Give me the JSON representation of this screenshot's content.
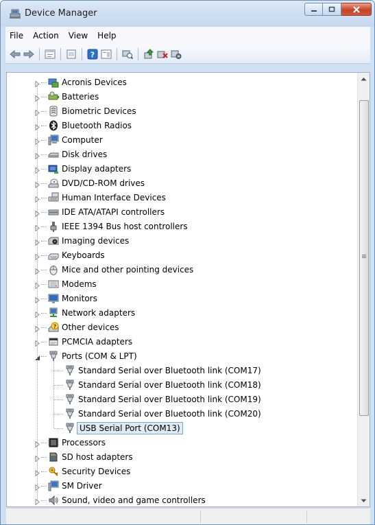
{
  "window": {
    "title": "Device Manager",
    "icons": {
      "app": "device-manager-icon",
      "minimize": "minimize-icon",
      "maximize": "maximize-icon",
      "close": "close-icon"
    },
    "accent": "#c7442a"
  },
  "menu": {
    "items": [
      "File",
      "Action",
      "View",
      "Help"
    ]
  },
  "toolbar": {
    "buttons": [
      "back-icon",
      "forward-icon",
      "properties-icon",
      "show-hidden-icon",
      "help-icon",
      "action-pane-icon",
      "scan-hardware-icon",
      "update-driver-icon",
      "uninstall-icon",
      "disable-icon"
    ]
  },
  "tree": {
    "nodes": [
      {
        "label": "Acronis Devices",
        "icon": "acronis-icon"
      },
      {
        "label": "Batteries",
        "icon": "battery-icon"
      },
      {
        "label": "Biometric Devices",
        "icon": "biometric-icon"
      },
      {
        "label": "Bluetooth Radios",
        "icon": "bluetooth-icon"
      },
      {
        "label": "Computer",
        "icon": "computer-icon"
      },
      {
        "label": "Disk drives",
        "icon": "disk-drive-icon"
      },
      {
        "label": "Display adapters",
        "icon": "display-adapter-icon"
      },
      {
        "label": "DVD/CD-ROM drives",
        "icon": "dvd-drive-icon"
      },
      {
        "label": "Human Interface Devices",
        "icon": "hid-icon"
      },
      {
        "label": "IDE ATA/ATAPI controllers",
        "icon": "ide-controller-icon"
      },
      {
        "label": "IEEE 1394 Bus host controllers",
        "icon": "ieee1394-icon"
      },
      {
        "label": "Imaging devices",
        "icon": "imaging-device-icon"
      },
      {
        "label": "Keyboards",
        "icon": "keyboard-icon"
      },
      {
        "label": "Mice and other pointing devices",
        "icon": "mouse-icon"
      },
      {
        "label": "Modems",
        "icon": "modem-icon"
      },
      {
        "label": "Monitors",
        "icon": "monitor-icon"
      },
      {
        "label": "Network adapters",
        "icon": "network-adapter-icon"
      },
      {
        "label": "Other devices",
        "icon": "unknown-device-icon"
      },
      {
        "label": "PCMCIA adapters",
        "icon": "pcmcia-icon"
      },
      {
        "label": "Ports (COM & LPT)",
        "icon": "port-icon",
        "expanded": true,
        "children": [
          {
            "label": "Standard Serial over Bluetooth link (COM17)",
            "icon": "port-icon"
          },
          {
            "label": "Standard Serial over Bluetooth link (COM18)",
            "icon": "port-icon"
          },
          {
            "label": "Standard Serial over Bluetooth link (COM19)",
            "icon": "port-icon"
          },
          {
            "label": "Standard Serial over Bluetooth link (COM20)",
            "icon": "port-icon"
          },
          {
            "label": "USB Serial Port (COM13)",
            "icon": "port-icon",
            "selected": true
          }
        ]
      },
      {
        "label": "Processors",
        "icon": "processor-icon"
      },
      {
        "label": "SD host adapters",
        "icon": "sd-host-icon"
      },
      {
        "label": "Security Devices",
        "icon": "security-device-icon"
      },
      {
        "label": "SM Driver",
        "icon": "sm-driver-icon"
      },
      {
        "label": "Sound, video and game controllers",
        "icon": "sound-icon"
      }
    ]
  }
}
